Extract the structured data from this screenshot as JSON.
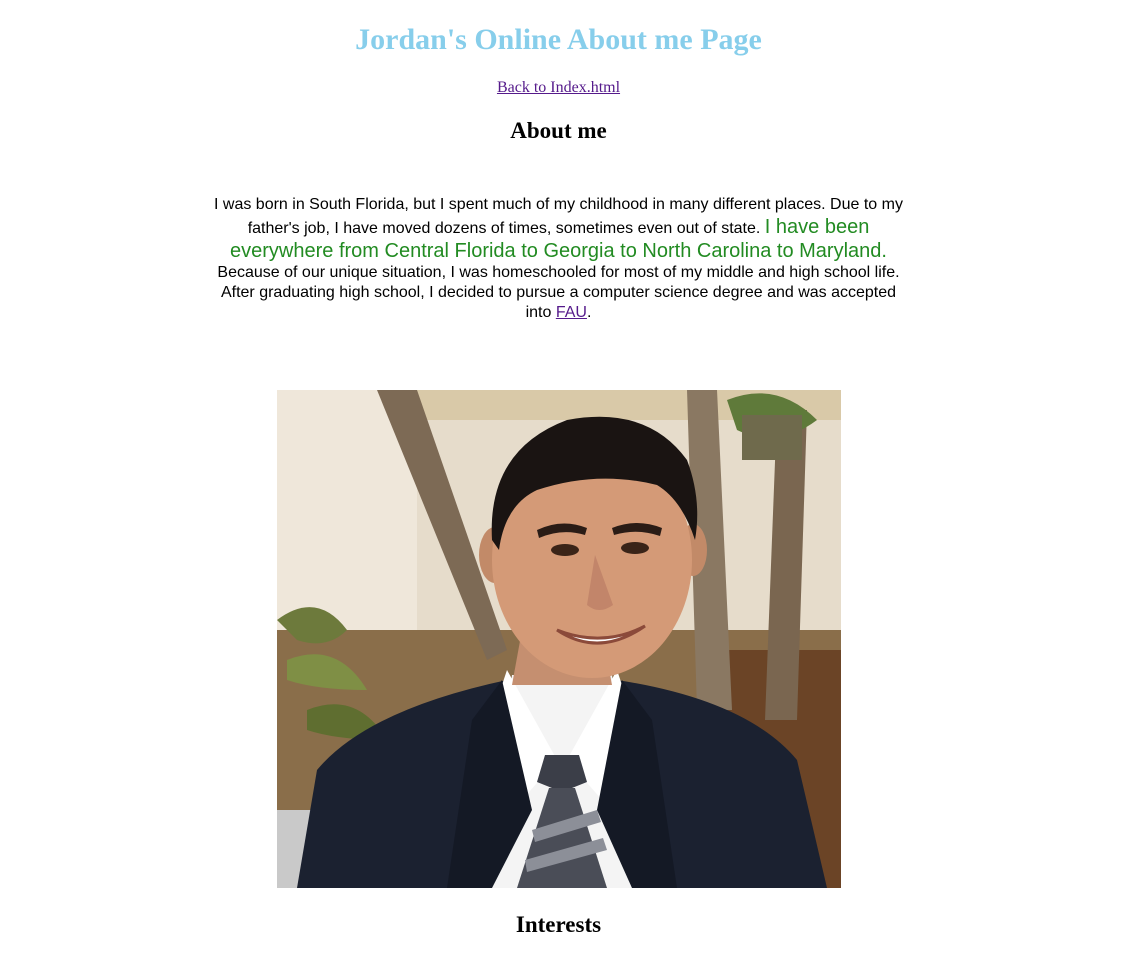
{
  "page": {
    "title": "Jordan's Online About me Page",
    "back_link": "Back to Index.html"
  },
  "about": {
    "heading": "About me",
    "text_1": "I was born in South Florida, but I spent much of my childhood in many different places. Due to my father's job, I have moved dozens of times, sometimes even out of state. ",
    "highlight": "I have been everywhere from Central Florida to Georgia to North Carolina to Maryland.",
    "text_2": " Because of our unique situation, I was homeschooled for most of my middle and high school life. After graduating high school, I decided to pursue a computer science degree and was accepted into ",
    "link": "FAU",
    "text_3": "."
  },
  "interests": {
    "heading": "Interests"
  },
  "colors": {
    "title": "#87ceeb",
    "highlight": "#228b22",
    "visited_link": "#551a8b"
  }
}
